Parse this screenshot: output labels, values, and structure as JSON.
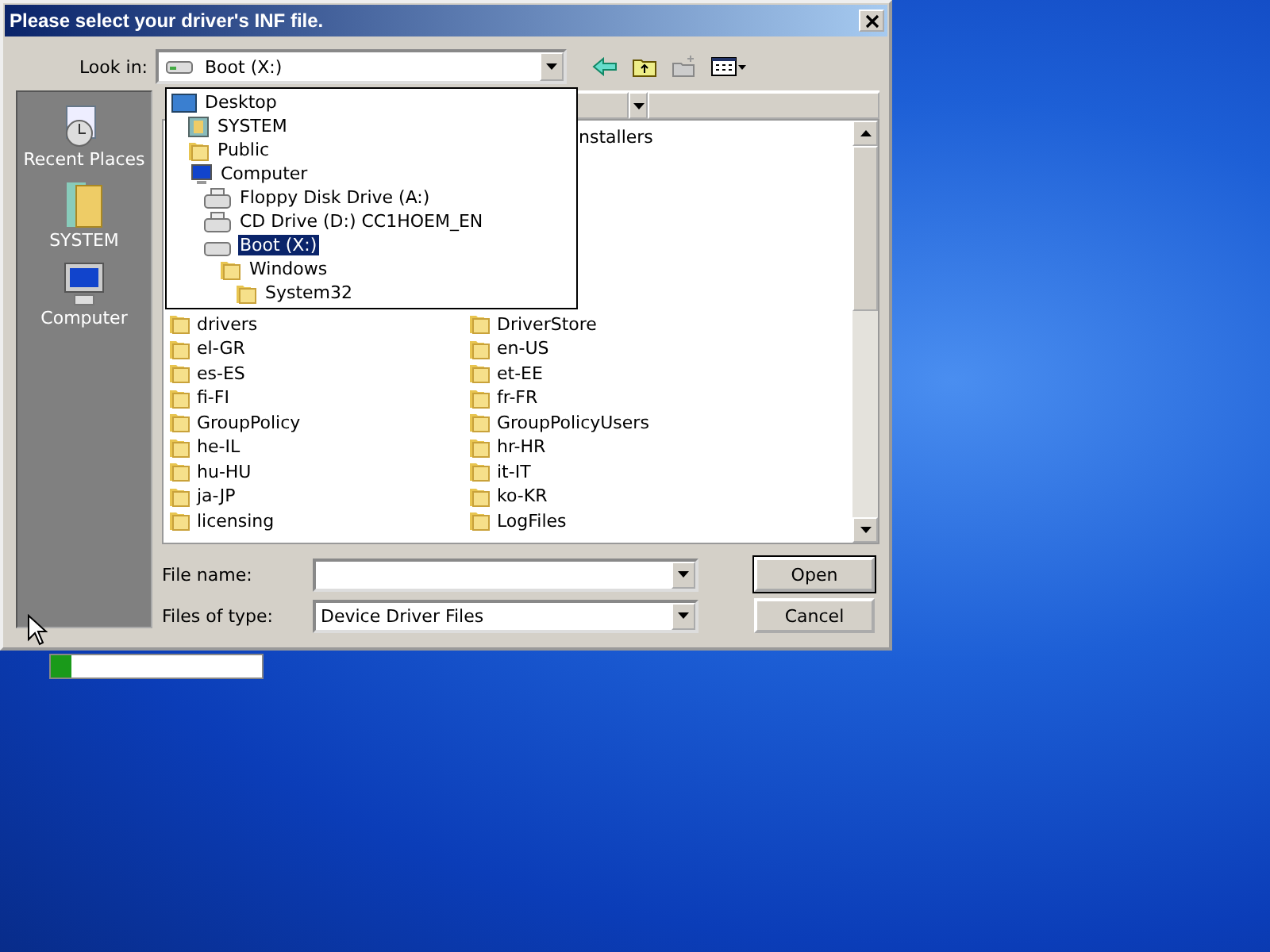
{
  "window": {
    "title": "Please select your driver's INF file."
  },
  "look_in": {
    "label": "Look in:",
    "value": "Boot (X:)"
  },
  "places": [
    {
      "label": "Recent Places",
      "kind": "recent"
    },
    {
      "label": "SYSTEM",
      "kind": "user"
    },
    {
      "label": "Computer",
      "kind": "computer"
    }
  ],
  "look_in_dropdown": [
    {
      "label": "Desktop",
      "kind": "desktop",
      "selected": false,
      "children": [
        {
          "label": "SYSTEM",
          "kind": "user",
          "selected": false
        },
        {
          "label": "Public",
          "kind": "folder",
          "selected": false
        },
        {
          "label": "Computer",
          "kind": "computer",
          "selected": false,
          "children": [
            {
              "label": "Floppy Disk Drive (A:)",
              "kind": "floppy",
              "selected": false
            },
            {
              "label": "CD Drive (D:) CC1HOEM_EN",
              "kind": "cd",
              "selected": false
            },
            {
              "label": "Boot (X:)",
              "kind": "drive",
              "selected": true,
              "children": [
                {
                  "label": "Windows",
                  "kind": "folder",
                  "selected": false,
                  "children": [
                    {
                      "label": "System32",
                      "kind": "folder",
                      "selected": false
                    }
                  ]
                }
              ]
            }
          ]
        }
      ]
    }
  ],
  "file_list": {
    "partly_hidden": [
      "nstallers"
    ],
    "rows": [
      [
        "drivers",
        "DriverStore"
      ],
      [
        "el-GR",
        "en-US"
      ],
      [
        "es-ES",
        "et-EE"
      ],
      [
        "fi-FI",
        "fr-FR"
      ],
      [
        "GroupPolicy",
        "GroupPolicyUsers"
      ],
      [
        "he-IL",
        "hr-HR"
      ],
      [
        "hu-HU",
        "it-IT"
      ],
      [
        "ja-JP",
        "ko-KR"
      ],
      [
        "licensing",
        "LogFiles"
      ]
    ]
  },
  "file_name": {
    "label": "File name:"
  },
  "files_of_type": {
    "label": "Files of type:",
    "value": "Device Driver Files"
  },
  "buttons": [
    "Open",
    "Cancel"
  ],
  "progress": {
    "level": 0.1
  }
}
